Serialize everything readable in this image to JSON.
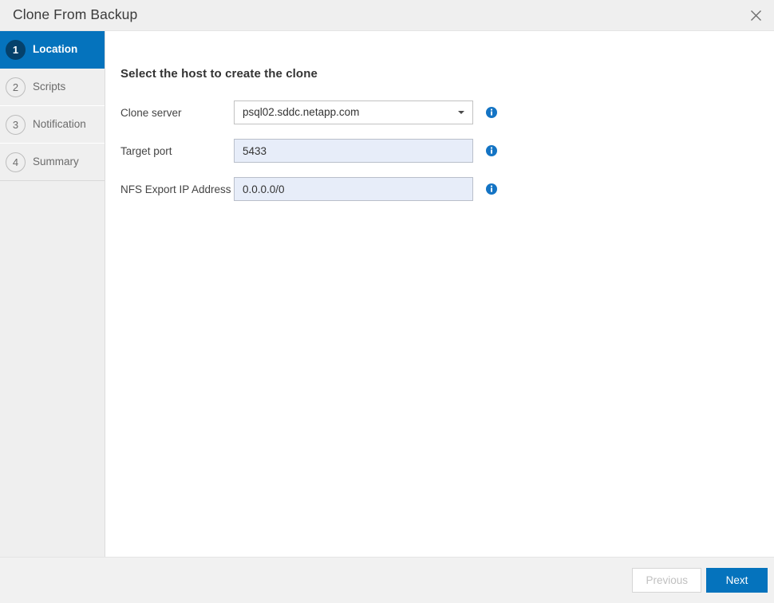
{
  "window": {
    "title": "Clone From Backup",
    "close_icon": "close-icon"
  },
  "sidebar": {
    "steps": [
      {
        "number": "1",
        "label": "Location",
        "active": true
      },
      {
        "number": "2",
        "label": "Scripts",
        "active": false
      },
      {
        "number": "3",
        "label": "Notification",
        "active": false
      },
      {
        "number": "4",
        "label": "Summary",
        "active": false
      }
    ]
  },
  "content": {
    "heading": "Select the host to create the clone",
    "fields": [
      {
        "label": "Clone server",
        "type": "select",
        "value": "psql02.sddc.netapp.com",
        "placeholder": "",
        "info_icon": "info-icon"
      },
      {
        "label": "Target port",
        "type": "text",
        "value": "5433",
        "placeholder": "",
        "info_icon": "info-icon"
      },
      {
        "label": "NFS Export IP Address",
        "type": "text",
        "value": "0.0.0.0/0",
        "placeholder": "",
        "info_icon": "info-icon"
      }
    ]
  },
  "footer": {
    "previous_label": "Previous",
    "next_label": "Next"
  },
  "colors": {
    "accent_blue": "#0573bd",
    "active_badge": "#05416b",
    "info_blue": "#1474c4",
    "titlebar_bg": "#efefef",
    "sidebar_bg": "#efefef",
    "input_fill": "#e7edf9"
  }
}
